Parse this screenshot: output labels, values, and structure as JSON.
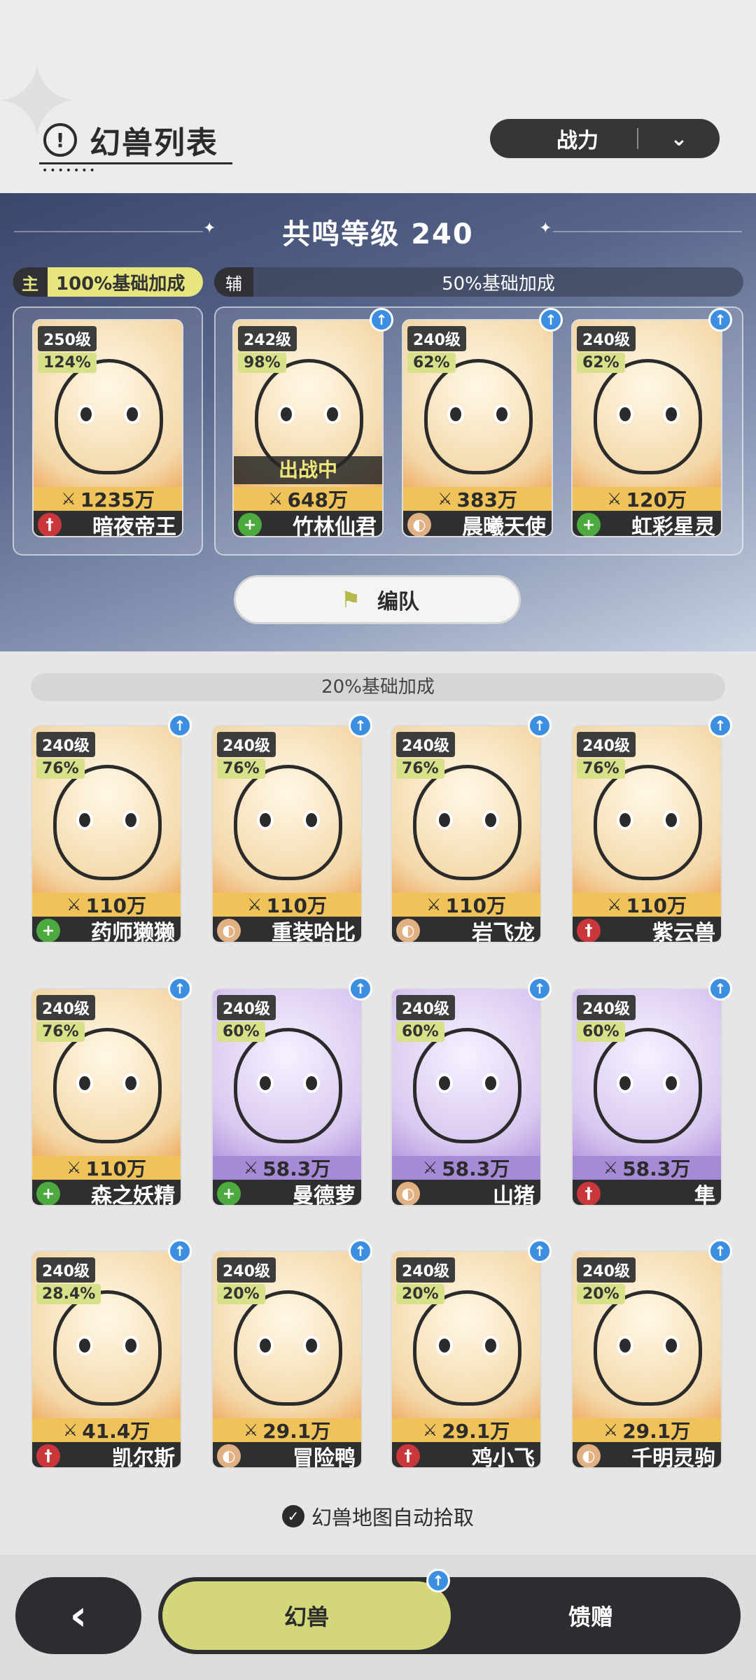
{
  "header": {
    "title": "幻兽列表",
    "sort_label": "战力"
  },
  "resonance": {
    "title": "共鸣等级 240",
    "main_tag": "主",
    "main_bonus": "100%基础加成",
    "aux_tag": "辅",
    "aux_bonus": "50%基础加成"
  },
  "team": [
    {
      "level": "250级",
      "pct": "124%",
      "power": "1235万",
      "name": "暗夜帝王",
      "role": "atk",
      "status": "",
      "up": false
    },
    {
      "level": "242级",
      "pct": "98%",
      "power": "648万",
      "name": "竹林仙君",
      "role": "heal",
      "status": "出战中",
      "up": true
    },
    {
      "level": "240级",
      "pct": "62%",
      "power": "383万",
      "name": "晨曦天使",
      "role": "def",
      "status": "",
      "up": true
    },
    {
      "level": "240级",
      "pct": "62%",
      "power": "120万",
      "name": "虹彩星灵",
      "role": "heal",
      "status": "",
      "up": true
    }
  ],
  "team_button": "编队",
  "bonus_20": "20%基础加成",
  "beasts": [
    {
      "level": "240级",
      "pct": "76%",
      "power": "110万",
      "name": "药师獭獭",
      "role": "heal",
      "theme": "orange"
    },
    {
      "level": "240级",
      "pct": "76%",
      "power": "110万",
      "name": "重装哈比",
      "role": "def",
      "theme": "orange"
    },
    {
      "level": "240级",
      "pct": "76%",
      "power": "110万",
      "name": "岩飞龙",
      "role": "def",
      "theme": "orange"
    },
    {
      "level": "240级",
      "pct": "76%",
      "power": "110万",
      "name": "紫云兽",
      "role": "atk",
      "theme": "orange"
    },
    {
      "level": "240级",
      "pct": "76%",
      "power": "110万",
      "name": "森之妖精",
      "role": "heal",
      "theme": "orange"
    },
    {
      "level": "240级",
      "pct": "60%",
      "power": "58.3万",
      "name": "曼德萝",
      "role": "heal",
      "theme": "purple"
    },
    {
      "level": "240级",
      "pct": "60%",
      "power": "58.3万",
      "name": "山猪",
      "role": "def",
      "theme": "purple"
    },
    {
      "level": "240级",
      "pct": "60%",
      "power": "58.3万",
      "name": "隼",
      "role": "atk",
      "theme": "purple"
    },
    {
      "level": "240级",
      "pct": "28.4%",
      "power": "41.4万",
      "name": "凯尔斯",
      "role": "atk",
      "theme": "orange"
    },
    {
      "level": "240级",
      "pct": "20%",
      "power": "29.1万",
      "name": "冒险鸭",
      "role": "def",
      "theme": "orange"
    },
    {
      "level": "240级",
      "pct": "20%",
      "power": "29.1万",
      "name": "鸡小飞",
      "role": "atk",
      "theme": "orange"
    },
    {
      "level": "240级",
      "pct": "20%",
      "power": "29.1万",
      "name": "千明灵驹",
      "role": "def",
      "theme": "orange"
    }
  ],
  "auto_pickup": "幻兽地图自动拾取",
  "footer": {
    "tab_beast": "幻兽",
    "tab_gift": "馈赠"
  },
  "icons": {
    "atk": "sword-icon",
    "heal": "plus-icon",
    "def": "shield-icon"
  },
  "colors": {
    "accent": "#d3d77a",
    "power_bar": "#f0c35a",
    "purple_bar": "#a58ad6",
    "upgrade": "#3c8fe0"
  }
}
